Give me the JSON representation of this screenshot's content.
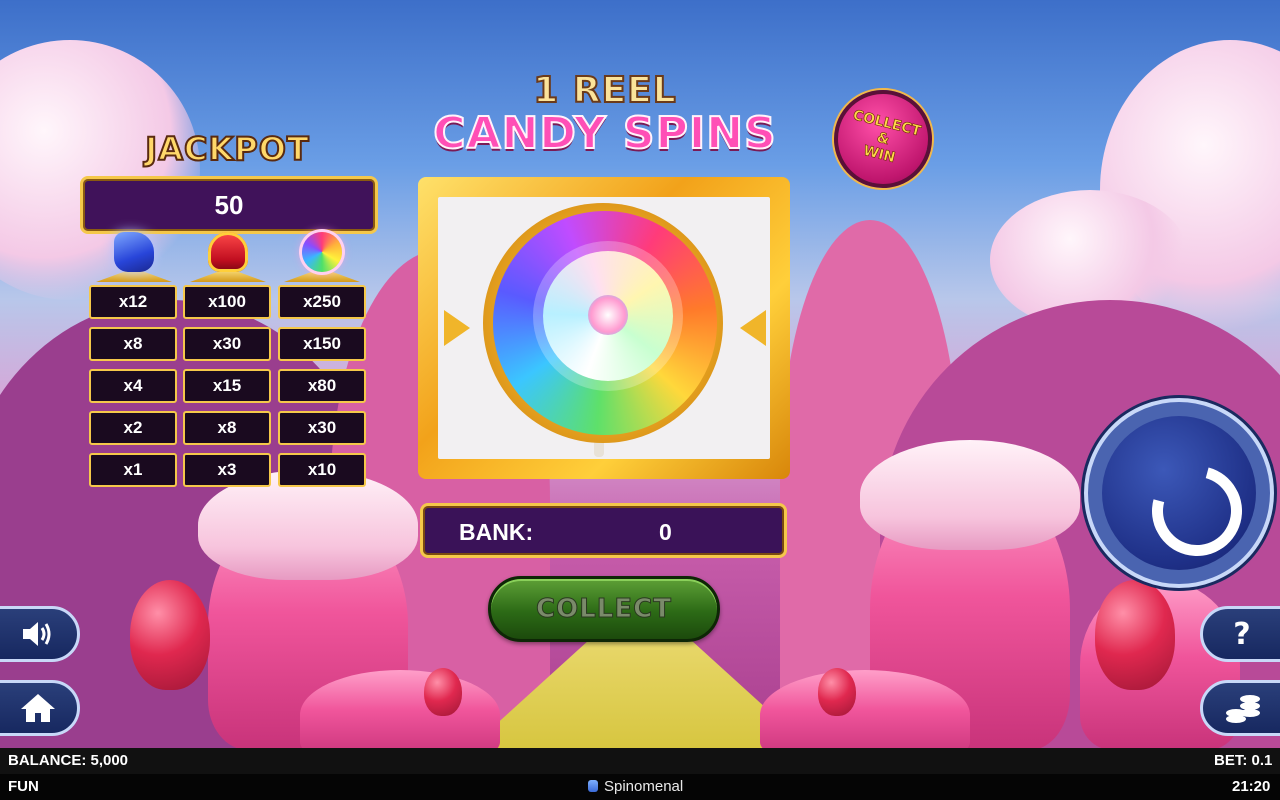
{
  "title": {
    "line1": "1 REEL",
    "line2": "CANDY SPINS"
  },
  "badge": {
    "line1": "COLLECT",
    "line2": "&",
    "line3": "WIN"
  },
  "jackpot": {
    "label": "JACKPOT",
    "value": "50",
    "columns": [
      {
        "icon": "whistle-icon",
        "multipliers": [
          "x12",
          "x8",
          "x4",
          "x2",
          "x1"
        ]
      },
      {
        "icon": "hat-icon",
        "multipliers": [
          "x100",
          "x30",
          "x15",
          "x8",
          "x3"
        ]
      },
      {
        "icon": "lollipop-icon",
        "multipliers": [
          "x250",
          "x150",
          "x80",
          "x30",
          "x10"
        ]
      }
    ]
  },
  "reel": {
    "symbol": "lollipop-icon"
  },
  "bank": {
    "label": "BANK:",
    "value": "0"
  },
  "buttons": {
    "collect": "COLLECT",
    "help": "?",
    "sound": "speaker-icon",
    "home": "home-icon",
    "bet": "coins-icon",
    "spin": "spin-icon"
  },
  "status": {
    "balance": "BALANCE: 5,000",
    "bet": "BET: 0.1",
    "mode": "FUN",
    "brand": "Spinomenal",
    "time": "21:20"
  },
  "colors": {
    "accent_gold": "#f5c84a",
    "panel_purple": "#3a1258",
    "spin_blue": "#1e2f86"
  }
}
